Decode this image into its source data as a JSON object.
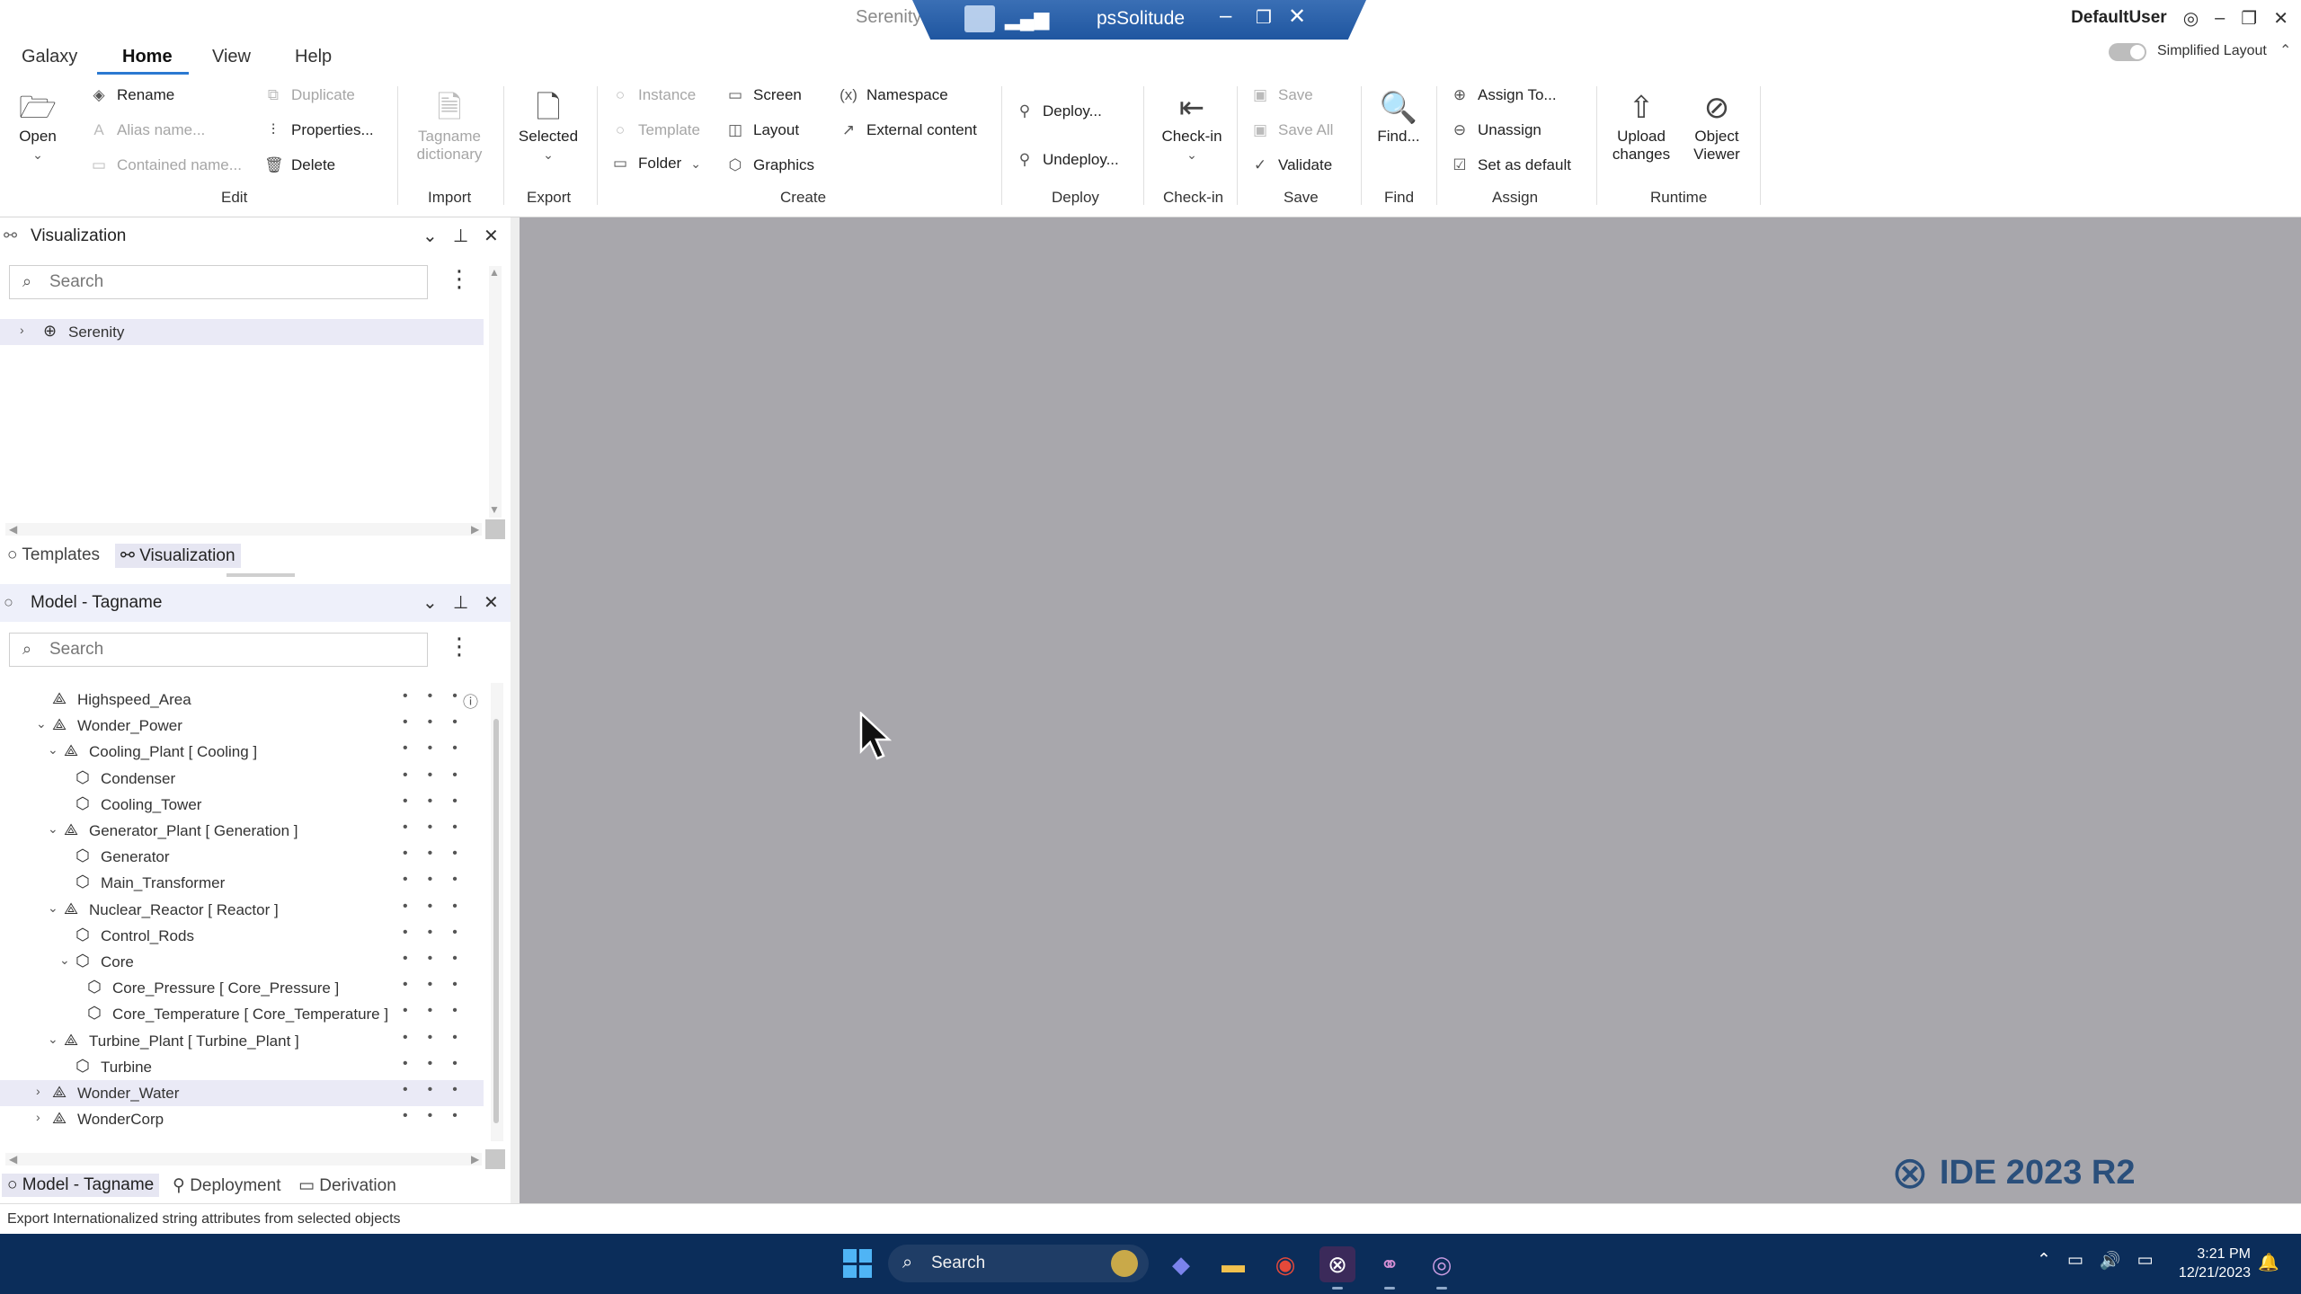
{
  "window": {
    "app_title": "Serenity",
    "remote_session_name": "psSolitude",
    "user_name": "DefaultUser"
  },
  "menu": {
    "items": [
      "Galaxy",
      "Home",
      "View",
      "Help"
    ],
    "active": "Home",
    "simplified_layout_label": "Simplified Layout"
  },
  "ribbon": {
    "edit": {
      "label": "Edit",
      "open": "Open",
      "rename": "Rename",
      "alias_name": "Alias name...",
      "contained_name": "Contained name...",
      "duplicate": "Duplicate",
      "properties": "Properties...",
      "delete": "Delete"
    },
    "import": {
      "label": "Import",
      "tagname_dictionary": "Tagname dictionary"
    },
    "export": {
      "label": "Export",
      "selected": "Selected"
    },
    "create": {
      "label": "Create",
      "instance": "Instance",
      "template": "Template",
      "folder": "Folder",
      "screen": "Screen",
      "layout": "Layout",
      "graphics": "Graphics",
      "namespace": "Namespace",
      "external_content": "External content"
    },
    "deploy": {
      "label": "Deploy",
      "deploy": "Deploy...",
      "undeploy": "Undeploy..."
    },
    "checkin": {
      "label": "Check-in",
      "checkin": "Check-in"
    },
    "save": {
      "label": "Save",
      "save": "Save",
      "save_all": "Save All",
      "validate": "Validate"
    },
    "find": {
      "label": "Find",
      "find": "Find..."
    },
    "assign": {
      "label": "Assign",
      "assign_to": "Assign To...",
      "unassign": "Unassign",
      "set_default": "Set as default"
    },
    "runtime": {
      "label": "Runtime",
      "upload_changes": "Upload changes",
      "object_viewer": "Object Viewer"
    }
  },
  "visualization_panel": {
    "title": "Visualization",
    "search_placeholder": "Search",
    "tree": [
      {
        "label": "Serenity"
      }
    ],
    "tabs": [
      "Templates",
      "Visualization"
    ],
    "active_tab": "Visualization"
  },
  "model_panel": {
    "title": "Model - Tagname",
    "search_placeholder": "Search",
    "tree": [
      {
        "label": "Highspeed_Area",
        "kind": "area",
        "level": 1,
        "expander": "",
        "info": true
      },
      {
        "label": "Wonder_Power",
        "kind": "area",
        "level": 1,
        "expander": "down"
      },
      {
        "label": "Cooling_Plant [ Cooling ]",
        "kind": "area",
        "level": 2,
        "expander": "down"
      },
      {
        "label": "Condenser",
        "kind": "object",
        "level": 3,
        "expander": ""
      },
      {
        "label": "Cooling_Tower",
        "kind": "object",
        "level": 3,
        "expander": ""
      },
      {
        "label": "Generator_Plant [ Generation ]",
        "kind": "area",
        "level": 2,
        "expander": "down"
      },
      {
        "label": "Generator",
        "kind": "object",
        "level": 3,
        "expander": ""
      },
      {
        "label": "Main_Transformer",
        "kind": "object",
        "level": 3,
        "expander": ""
      },
      {
        "label": "Nuclear_Reactor [ Reactor ]",
        "kind": "area",
        "level": 2,
        "expander": "down"
      },
      {
        "label": "Control_Rods",
        "kind": "object",
        "level": 3,
        "expander": ""
      },
      {
        "label": "Core",
        "kind": "object",
        "level": 3,
        "expander": "down"
      },
      {
        "label": "Core_Pressure [ Core_Pressure ]",
        "kind": "object",
        "level": 4,
        "expander": ""
      },
      {
        "label": "Core_Temperature [ Core_Temperature ]",
        "kind": "object",
        "level": 4,
        "expander": ""
      },
      {
        "label": "Turbine_Plant [ Turbine_Plant ]",
        "kind": "area",
        "level": 2,
        "expander": "down"
      },
      {
        "label": "Turbine",
        "kind": "object",
        "level": 3,
        "expander": ""
      },
      {
        "label": "Wonder_Water",
        "kind": "area",
        "level": 1,
        "expander": "right",
        "selected": true
      },
      {
        "label": "WonderCorp",
        "kind": "area",
        "level": 1,
        "expander": "right"
      }
    ],
    "tabs": [
      "Model - Tagname",
      "Deployment",
      "Derivation"
    ],
    "active_tab": "Model - Tagname"
  },
  "canvas": {
    "logo_text": "IDE 2023 R2"
  },
  "status_bar": {
    "text": "Export Internationalized string attributes from selected objects"
  },
  "taskbar": {
    "search_placeholder": "Search",
    "apps": [
      "teams-icon",
      "file-explorer-icon",
      "chrome-icon",
      "ide-icon",
      "app-icon",
      "app2-icon"
    ],
    "time": "3:21 PM",
    "date": "12/21/2023"
  },
  "colors": {
    "accent": "#2b79d1",
    "canvas": "#a8a7ac",
    "taskbar": "#0b2d5a",
    "logo": "#2a4f7b"
  }
}
